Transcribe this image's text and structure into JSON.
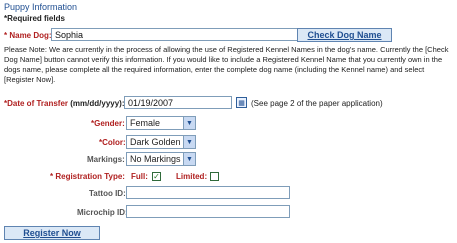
{
  "section": {
    "title": "Puppy Information",
    "required_note": "*Required fields"
  },
  "name_dog": {
    "label": "* Name Dog:",
    "value": "Sophia",
    "check_button": "Check Dog Name"
  },
  "note": "Please Note: We are currently in the process of allowing the use of Registered Kennel Names in the dog's name. Currently the [Check Dog Name] button cannot verify this information. If you would like to include a Registered Kennel Name that you currently own in the dogs name, please complete all the required information, enter the complete dog name (including the Kennel name) and select [Register Now].",
  "date_transfer": {
    "label": "*Date of Transfer",
    "format": "(mm/dd/yyyy):",
    "value": "01/19/2007",
    "hint": "(See page 2 of the paper application)"
  },
  "gender": {
    "label": "*Gender:",
    "value": "Female"
  },
  "color": {
    "label": "*Color:",
    "value": "Dark Golden"
  },
  "markings": {
    "label": "Markings:",
    "value": "No Markings"
  },
  "registration": {
    "label": "* Registration Type:",
    "full_label": "Full:",
    "full_checked": true,
    "limited_label": "Limited:",
    "limited_checked": false
  },
  "tattoo": {
    "label": "Tattoo ID:",
    "value": ""
  },
  "microchip": {
    "label": "Microchip ID:",
    "value": ""
  },
  "register_button": "Register Now"
}
